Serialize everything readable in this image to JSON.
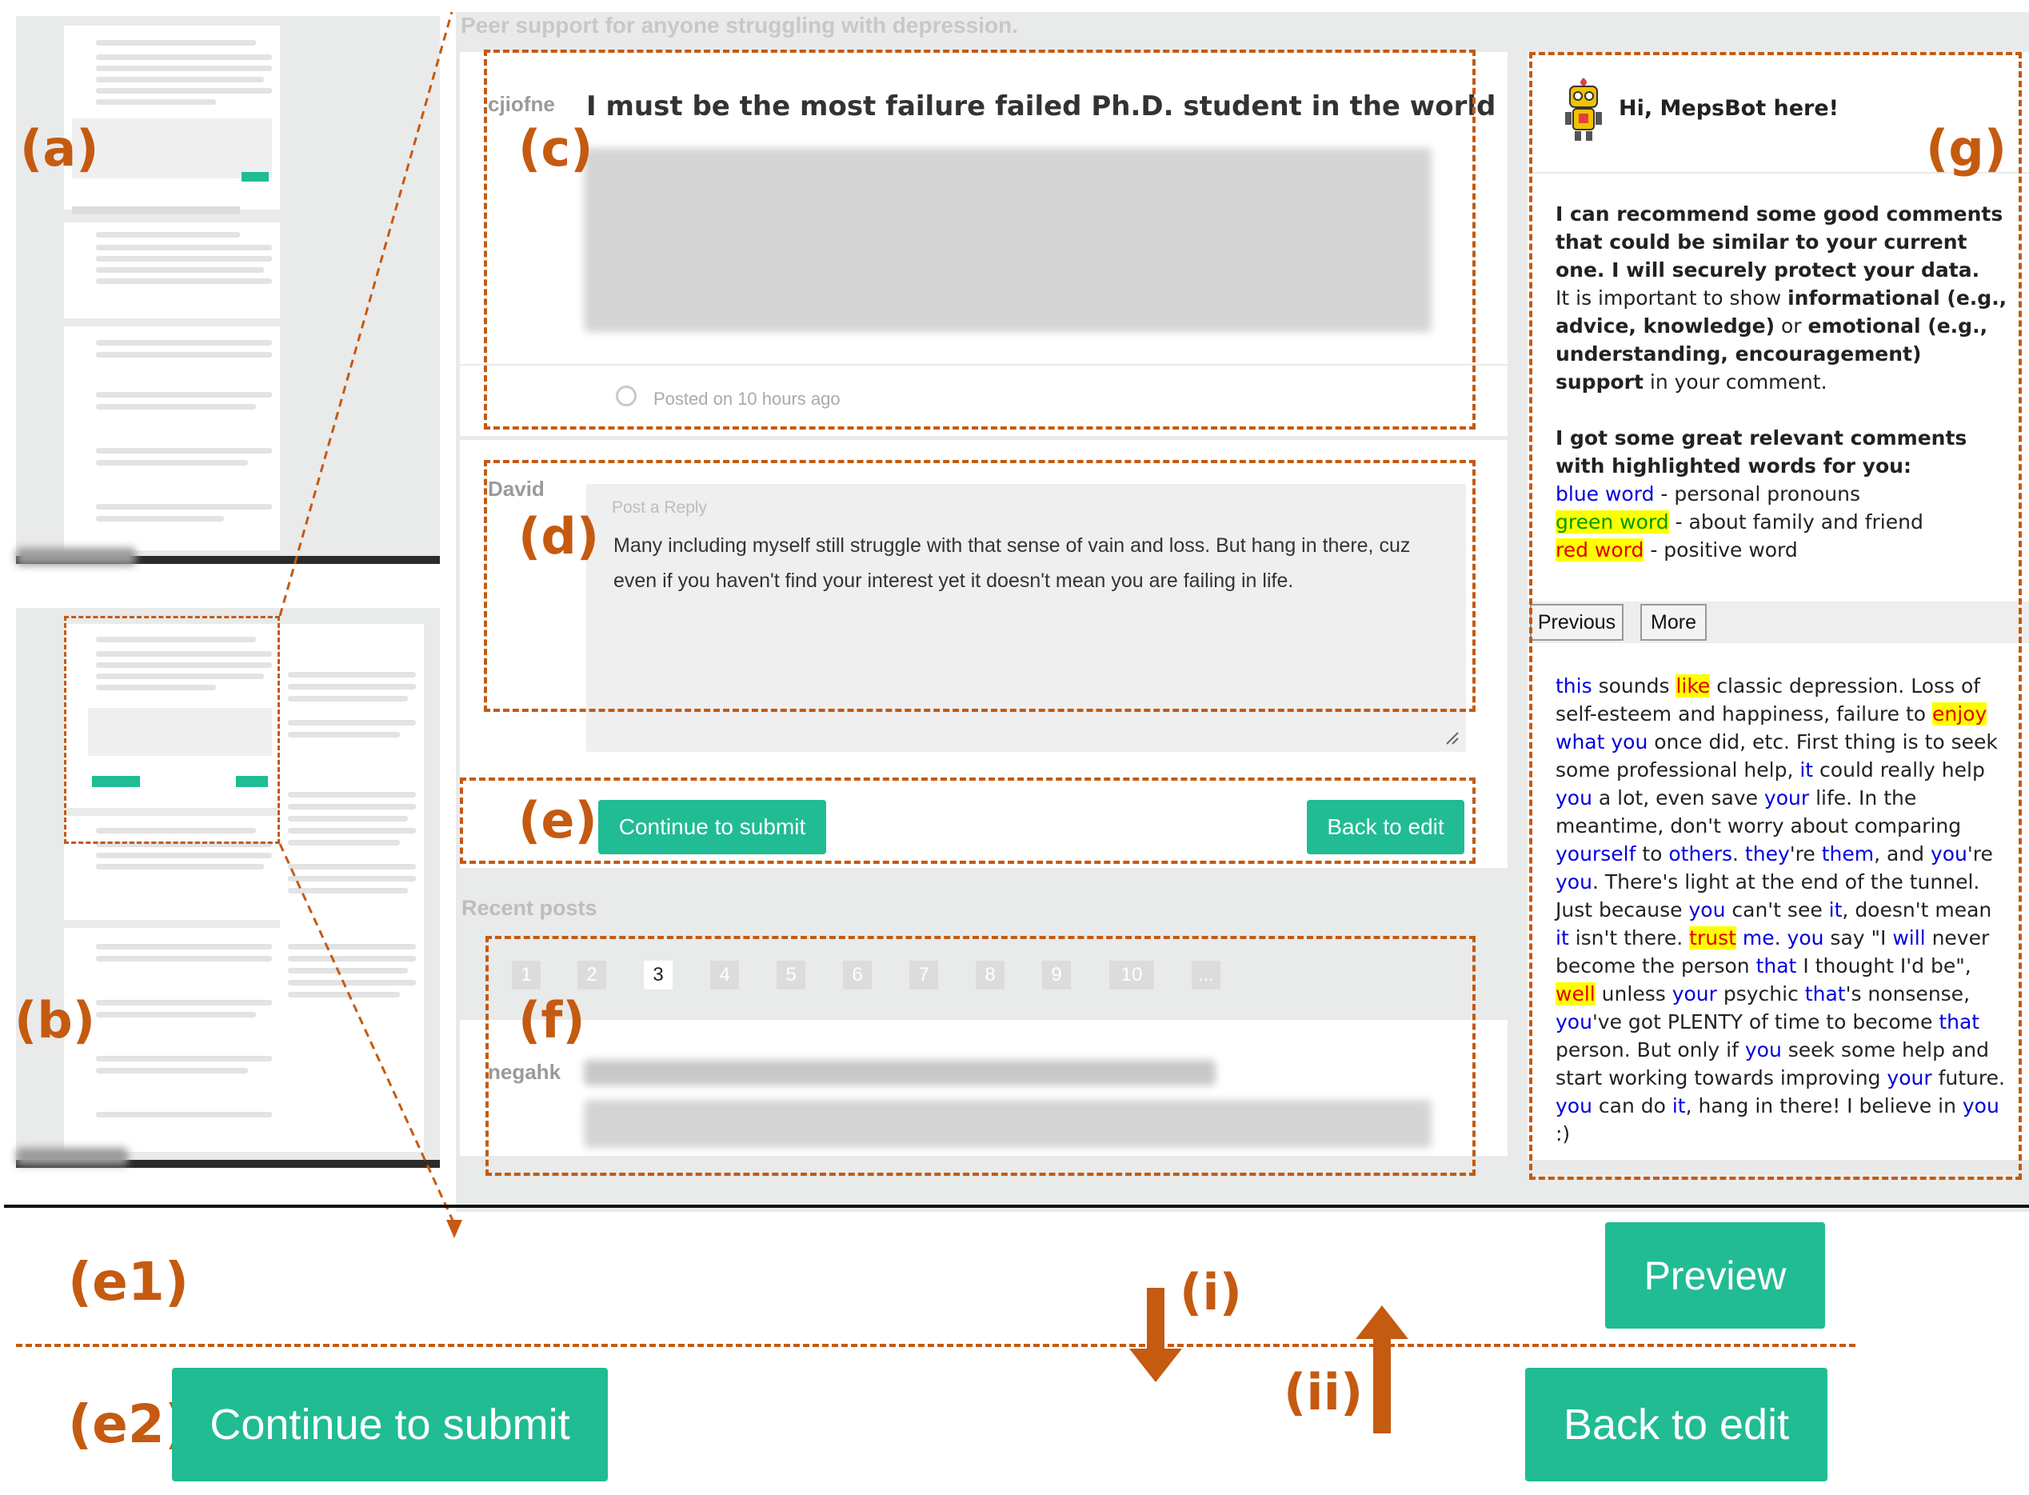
{
  "header": {
    "subtitle": "Peer support for anyone struggling with depression."
  },
  "post": {
    "author": "cjiofne",
    "title": "I must be the most failure failed Ph.D. student in the world",
    "posted": "Posted on 10 hours ago"
  },
  "reply": {
    "author": "David",
    "placeholder": "Post a Reply",
    "text": "Many including myself still struggle with that sense of vain and loss. But hang in there, cuz even if you haven't find your interest yet it doesn't mean you are failing in life."
  },
  "actions": {
    "submit": "Continue to submit",
    "back": "Back to edit",
    "preview": "Preview"
  },
  "recent": {
    "heading": "Recent posts",
    "pages": [
      "1",
      "2",
      "3",
      "4",
      "5",
      "6",
      "7",
      "8",
      "9",
      "10",
      "..."
    ],
    "active_page": "3",
    "next_author": "negahk"
  },
  "bot": {
    "greeting": "Hi, MepsBot here!",
    "intro_bold": "I can recommend some good comments that could be similar to your current one. I will securely protect your data.",
    "p2_a": "It is important to show",
    "p2_b": "informational (e.g., advice, knowledge)",
    "p2_c": "or",
    "p2_d": "emotional (e.g., understanding, encouragement) support",
    "p2_e": "in your comment.",
    "highlight_heading": "I got some great relevant comments with highlighted words for you:",
    "legend": [
      {
        "word": "blue word",
        "desc": "- personal pronouns"
      },
      {
        "word": "green word",
        "desc": "- about family and friend"
      },
      {
        "word": "red word",
        "desc": "- positive word"
      }
    ],
    "nav_prev": "Previous",
    "nav_more": "More"
  },
  "suggestion": [
    {
      "t": "this",
      "c": "b"
    },
    {
      "t": " sounds "
    },
    {
      "t": "like",
      "c": "r"
    },
    {
      "t": " classic depression. Loss of self-esteem and happiness, failure to "
    },
    {
      "t": "enjoy",
      "c": "r"
    },
    {
      "t": " "
    },
    {
      "t": "what you",
      "c": "b"
    },
    {
      "t": " once did, etc. First thing is to seek some professional help, "
    },
    {
      "t": "it",
      "c": "b"
    },
    {
      "t": " could really help "
    },
    {
      "t": "you",
      "c": "b"
    },
    {
      "t": " a lot, even save "
    },
    {
      "t": "your",
      "c": "b"
    },
    {
      "t": " life. In the meantime, don't worry about comparing "
    },
    {
      "t": "yourself",
      "c": "b"
    },
    {
      "t": " to "
    },
    {
      "t": "others",
      "c": "b"
    },
    {
      "t": ". "
    },
    {
      "t": "they",
      "c": "b"
    },
    {
      "t": "'re "
    },
    {
      "t": "them",
      "c": "b"
    },
    {
      "t": ", and "
    },
    {
      "t": "you",
      "c": "b"
    },
    {
      "t": "'re "
    },
    {
      "t": "you",
      "c": "b"
    },
    {
      "t": ". There's light at the end of the tunnel. Just because "
    },
    {
      "t": "you",
      "c": "b"
    },
    {
      "t": " can't see "
    },
    {
      "t": "it",
      "c": "b"
    },
    {
      "t": ", doesn't mean "
    },
    {
      "t": "it",
      "c": "b"
    },
    {
      "t": " isn't there. "
    },
    {
      "t": "trust",
      "c": "r"
    },
    {
      "t": " "
    },
    {
      "t": "me",
      "c": "b"
    },
    {
      "t": ". "
    },
    {
      "t": "you",
      "c": "b"
    },
    {
      "t": " say \"I "
    },
    {
      "t": "will",
      "c": "b"
    },
    {
      "t": " never become the person "
    },
    {
      "t": "that",
      "c": "b"
    },
    {
      "t": " I thought I'd be\", "
    },
    {
      "t": "well",
      "c": "r"
    },
    {
      "t": " unless "
    },
    {
      "t": "your",
      "c": "b"
    },
    {
      "t": " psychic "
    },
    {
      "t": "that",
      "c": "b"
    },
    {
      "t": "'s nonsense, "
    },
    {
      "t": "you",
      "c": "b"
    },
    {
      "t": "'ve got PLENTY of time to become "
    },
    {
      "t": "that",
      "c": "b"
    },
    {
      "t": " person. But only if "
    },
    {
      "t": "you",
      "c": "b"
    },
    {
      "t": " seek some help and start working towards improving "
    },
    {
      "t": "your",
      "c": "b"
    },
    {
      "t": " future. "
    },
    {
      "t": "you",
      "c": "b"
    },
    {
      "t": " can do "
    },
    {
      "t": "it",
      "c": "b"
    },
    {
      "t": ", hang in there! I believe in "
    },
    {
      "t": "you",
      "c": "b"
    },
    {
      "t": " :)"
    }
  ],
  "labels": {
    "a": "(a)",
    "b": "(b)",
    "c": "(c)",
    "d": "(d)",
    "e": "(e)",
    "f": "(f)",
    "g": "(g)",
    "e1": "(e1)",
    "e2": "(e2)",
    "i": "(i)",
    "ii": "(ii)"
  },
  "colors": {
    "accent": "#21bc94",
    "annotation": "#c55a11",
    "panel": "#e9eaea",
    "pronoun": "#0000dd",
    "positive": "#e00000",
    "family": "#009900",
    "highlight": "#ffff00"
  }
}
